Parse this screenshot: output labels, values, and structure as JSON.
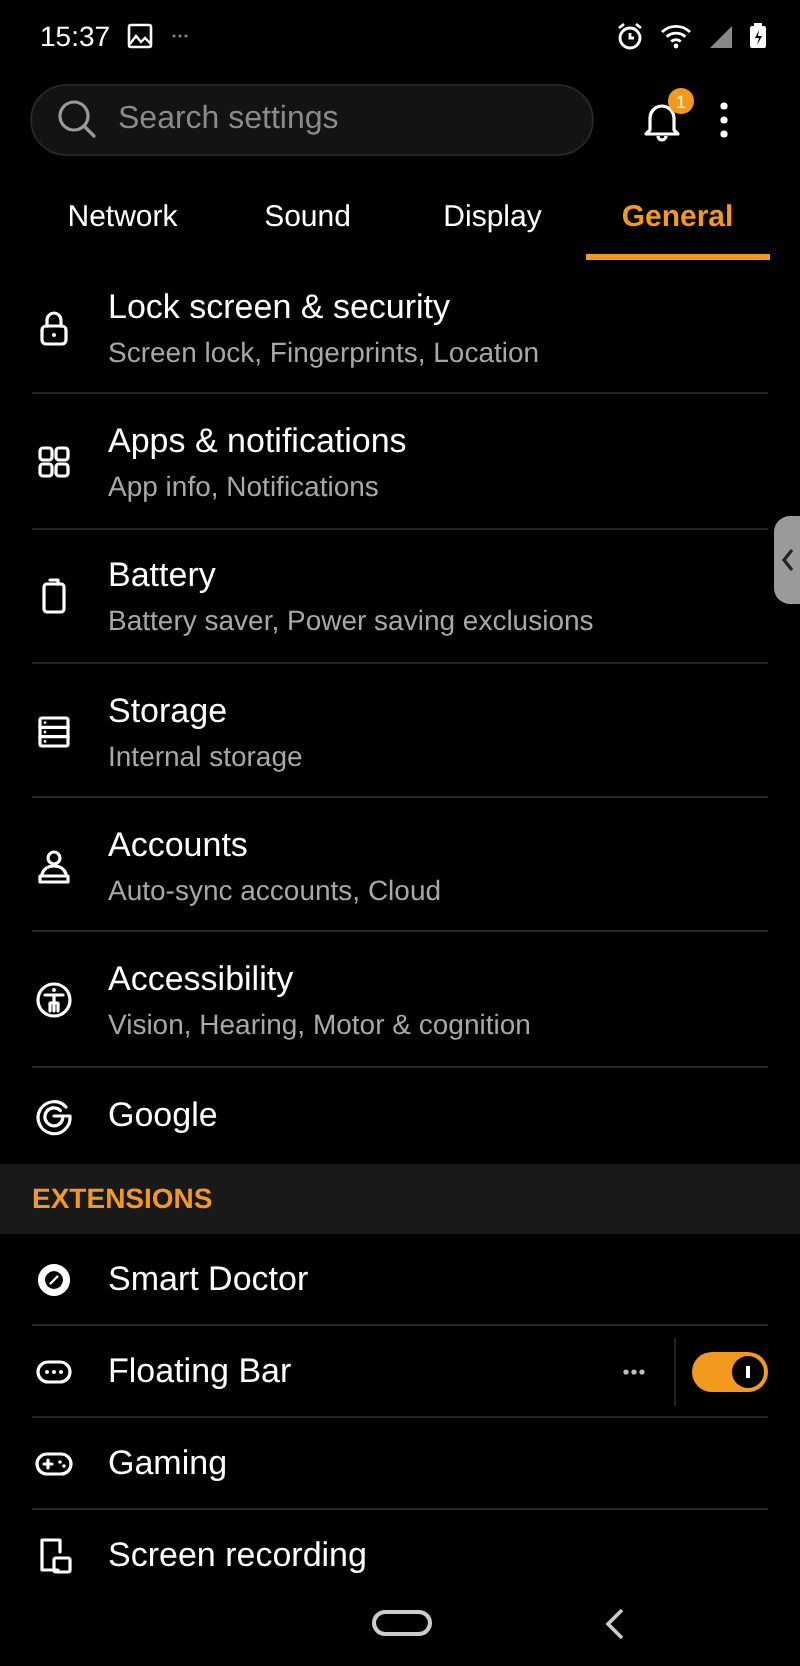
{
  "status_bar": {
    "time": "15:37"
  },
  "search": {
    "placeholder": "Search settings"
  },
  "notifications": {
    "badge": "1"
  },
  "tabs": [
    {
      "label": "Network",
      "selected": false
    },
    {
      "label": "Sound",
      "selected": false
    },
    {
      "label": "Display",
      "selected": false
    },
    {
      "label": "General",
      "selected": true
    }
  ],
  "items": [
    {
      "title": "Lock screen & security",
      "subtitle": "Screen lock, Fingerprints, Location"
    },
    {
      "title": "Apps & notifications",
      "subtitle": "App info, Notifications"
    },
    {
      "title": "Battery",
      "subtitle": "Battery saver, Power saving exclusions"
    },
    {
      "title": "Storage",
      "subtitle": "Internal storage"
    },
    {
      "title": "Accounts",
      "subtitle": "Auto-sync accounts, Cloud"
    },
    {
      "title": "Accessibility",
      "subtitle": "Vision, Hearing, Motor & cognition"
    },
    {
      "title": "Google"
    }
  ],
  "extensions": {
    "header": "EXTENSIONS",
    "items": [
      {
        "kind": "plain",
        "title": "Smart Doctor"
      },
      {
        "kind": "toggle",
        "title": "Floating Bar",
        "on": true
      },
      {
        "kind": "plain",
        "title": "Gaming"
      },
      {
        "kind": "plain",
        "title": "Screen recording"
      }
    ]
  }
}
